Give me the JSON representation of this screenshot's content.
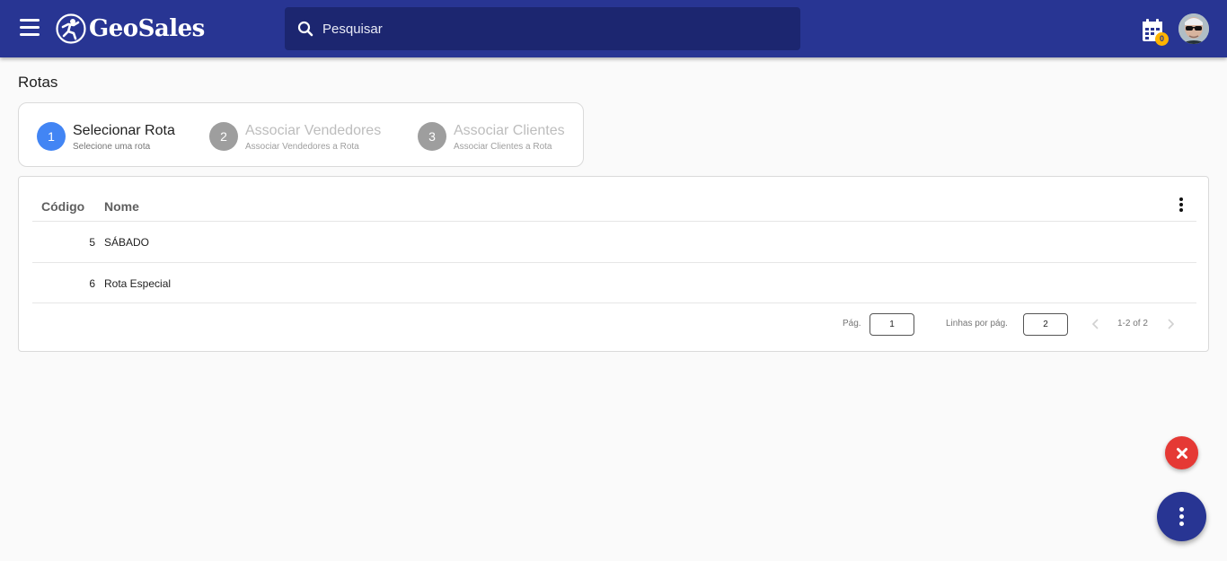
{
  "header": {
    "app_name": "GeoSales",
    "search_placeholder": "Pesquisar",
    "notification_count": "0",
    "colors": {
      "bar": "#283593",
      "search_bg": "#1c2670",
      "badge": "#ffb300"
    },
    "icons": [
      "menu-icon",
      "logo-icon",
      "search-icon",
      "calendar-icon",
      "avatar"
    ]
  },
  "page": {
    "title": "Rotas"
  },
  "stepper": {
    "steps": [
      {
        "number": "1",
        "title": "Selecionar Rota",
        "subtitle": "Selecione uma rota",
        "state": "active",
        "color": "#4285f4"
      },
      {
        "number": "2",
        "title": "Associar Vendedores",
        "subtitle": "Associar Vendedores a Rota",
        "state": "inactive",
        "color": "#9e9e9e"
      },
      {
        "number": "3",
        "title": "Associar Clientes",
        "subtitle": "Associar Clientes a Rota",
        "state": "inactive",
        "color": "#9e9e9e"
      }
    ]
  },
  "table": {
    "columns": {
      "code": "Código",
      "name": "Nome"
    },
    "rows": [
      {
        "code": "5",
        "name": "SÁBADO"
      },
      {
        "code": "6",
        "name": "Rota Especial"
      }
    ],
    "pagination": {
      "page_label": "Pág.",
      "page_value": "1",
      "rows_label": "Linhas por pág.",
      "rows_value": "2",
      "range": "1-2 of 2"
    }
  },
  "fabs": {
    "close_color": "#e53935",
    "more_color": "#283593"
  }
}
